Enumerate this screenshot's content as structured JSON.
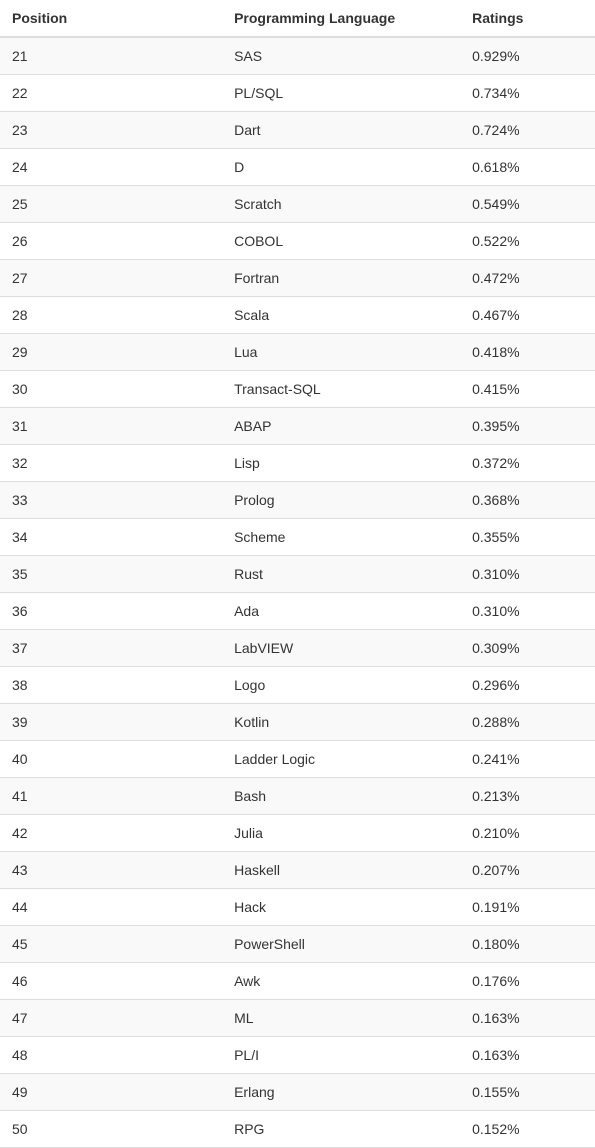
{
  "table": {
    "headers": {
      "position": "Position",
      "language": "Programming Language",
      "ratings": "Ratings"
    },
    "rows": [
      {
        "position": "21",
        "language": "SAS",
        "ratings": "0.929%"
      },
      {
        "position": "22",
        "language": "PL/SQL",
        "ratings": "0.734%"
      },
      {
        "position": "23",
        "language": "Dart",
        "ratings": "0.724%"
      },
      {
        "position": "24",
        "language": "D",
        "ratings": "0.618%"
      },
      {
        "position": "25",
        "language": "Scratch",
        "ratings": "0.549%"
      },
      {
        "position": "26",
        "language": "COBOL",
        "ratings": "0.522%"
      },
      {
        "position": "27",
        "language": "Fortran",
        "ratings": "0.472%"
      },
      {
        "position": "28",
        "language": "Scala",
        "ratings": "0.467%"
      },
      {
        "position": "29",
        "language": "Lua",
        "ratings": "0.418%"
      },
      {
        "position": "30",
        "language": "Transact-SQL",
        "ratings": "0.415%"
      },
      {
        "position": "31",
        "language": "ABAP",
        "ratings": "0.395%"
      },
      {
        "position": "32",
        "language": "Lisp",
        "ratings": "0.372%"
      },
      {
        "position": "33",
        "language": "Prolog",
        "ratings": "0.368%"
      },
      {
        "position": "34",
        "language": "Scheme",
        "ratings": "0.355%"
      },
      {
        "position": "35",
        "language": "Rust",
        "ratings": "0.310%"
      },
      {
        "position": "36",
        "language": "Ada",
        "ratings": "0.310%"
      },
      {
        "position": "37",
        "language": "LabVIEW",
        "ratings": "0.309%"
      },
      {
        "position": "38",
        "language": "Logo",
        "ratings": "0.296%"
      },
      {
        "position": "39",
        "language": "Kotlin",
        "ratings": "0.288%"
      },
      {
        "position": "40",
        "language": "Ladder Logic",
        "ratings": "0.241%"
      },
      {
        "position": "41",
        "language": "Bash",
        "ratings": "0.213%"
      },
      {
        "position": "42",
        "language": "Julia",
        "ratings": "0.210%"
      },
      {
        "position": "43",
        "language": "Haskell",
        "ratings": "0.207%"
      },
      {
        "position": "44",
        "language": "Hack",
        "ratings": "0.191%"
      },
      {
        "position": "45",
        "language": "PowerShell",
        "ratings": "0.180%"
      },
      {
        "position": "46",
        "language": "Awk",
        "ratings": "0.176%"
      },
      {
        "position": "47",
        "language": "ML",
        "ratings": "0.163%"
      },
      {
        "position": "48",
        "language": "PL/I",
        "ratings": "0.163%"
      },
      {
        "position": "49",
        "language": "Erlang",
        "ratings": "0.155%"
      },
      {
        "position": "50",
        "language": "RPG",
        "ratings": "0.152%"
      }
    ]
  }
}
